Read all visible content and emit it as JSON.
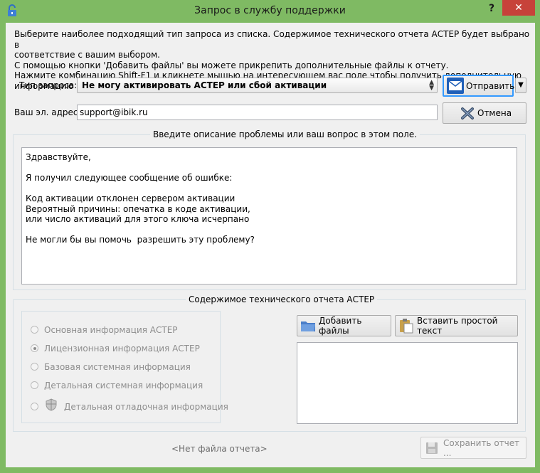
{
  "window": {
    "title": "Запрос в службу поддержки",
    "help_label": "?",
    "close_label": "✕"
  },
  "intro": {
    "line1": "Выберите наиболее подходящий тип запроса из списка. Содержимое технического отчета АСТЕР будет выбрано в",
    "line2": "соответствие с вашим выбором.",
    "line3": "С помощью кнопки 'Добавить файлы' вы можете прикрепить дополнительные файлы к отчету.",
    "line4": "Нажмите комбинацию Shift-F1 и кликнете мышью на интересующем вас поле чтобы получить дополнительную информацию"
  },
  "form": {
    "request_type_label": "Тип запроса:",
    "request_type_value": "Не могу активировать АСТЕР или сбой активации",
    "email_label": "Ваш эл. адрес:",
    "email_value": "support@ibik.ru"
  },
  "buttons": {
    "send": "Отправить",
    "cancel": "Отмена",
    "add_files": "Добавить файлы",
    "paste_text": "Вставить простой текст",
    "save_report": "Сохранить отчет ..."
  },
  "description": {
    "group_title": "Введите описание проблемы или ваш вопрос в этом поле.",
    "text": "Здравствуйте,\n\nЯ получил следующее сообщение об ошибке:\n\nКод активации отклонен сервером активации\nВероятный причины: опечатка в коде активации,\nили число активаций для этого ключа исчерпано\n\nНе могли бы вы помочь  разрешить эту проблему?"
  },
  "report": {
    "group_title": "Содержимое технического отчета АСТЕР",
    "options": [
      {
        "label": "Основная информация АСТЕР",
        "checked": false
      },
      {
        "label": "Лицензионная информация АСТЕР",
        "checked": true
      },
      {
        "label": "Базовая системная информация",
        "checked": false
      },
      {
        "label": "Детальная системная информация",
        "checked": false
      },
      {
        "label": "Детальная отладочная информация",
        "checked": false
      }
    ],
    "no_file": "<Нет файла отчета>"
  },
  "colors": {
    "frame": "#7fba63",
    "close": "#c7423a",
    "focus": "#3399ff"
  },
  "icons": {
    "app": "lock-icon",
    "send": "envelope-icon",
    "cancel": "x-icon",
    "add_files": "folder-icon",
    "paste": "clipboard-icon",
    "save": "floppy-icon",
    "debug": "shield-icon"
  }
}
